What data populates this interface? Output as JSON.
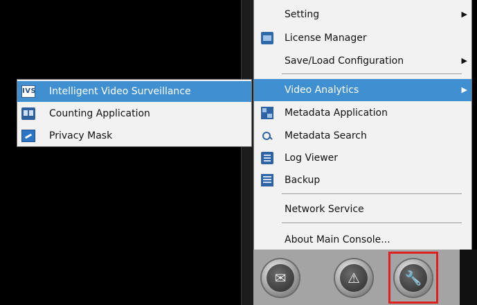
{
  "menu": {
    "setting": "Setting",
    "license_manager": "License Manager",
    "save_load": "Save/Load Configuration",
    "video_analytics": "Video Analytics",
    "metadata_application": "Metadata Application",
    "metadata_search": "Metadata Search",
    "log_viewer": "Log Viewer",
    "backup": "Backup",
    "network_service": "Network Service",
    "about": "About Main Console..."
  },
  "submenu": {
    "ivs": "Intelligent Video Surveillance",
    "counting": "Counting Application",
    "privacy": "Privacy Mask",
    "ivs_icon_text": "IVS"
  },
  "colors": {
    "highlight": "#3f8fd1",
    "menu_bg": "#f2f2f2",
    "selection_box": "#e0201e"
  },
  "icons": {
    "license": "license-icon",
    "metadata_application": "metadata-application-icon",
    "metadata_search": "metadata-search-icon",
    "log_viewer": "log-viewer-icon",
    "backup": "backup-icon",
    "ivs": "ivs-icon",
    "counting": "counting-icon",
    "privacy": "privacy-mask-icon",
    "bottom": [
      "script-icon",
      "warning-icon",
      "wrench-icon"
    ]
  }
}
